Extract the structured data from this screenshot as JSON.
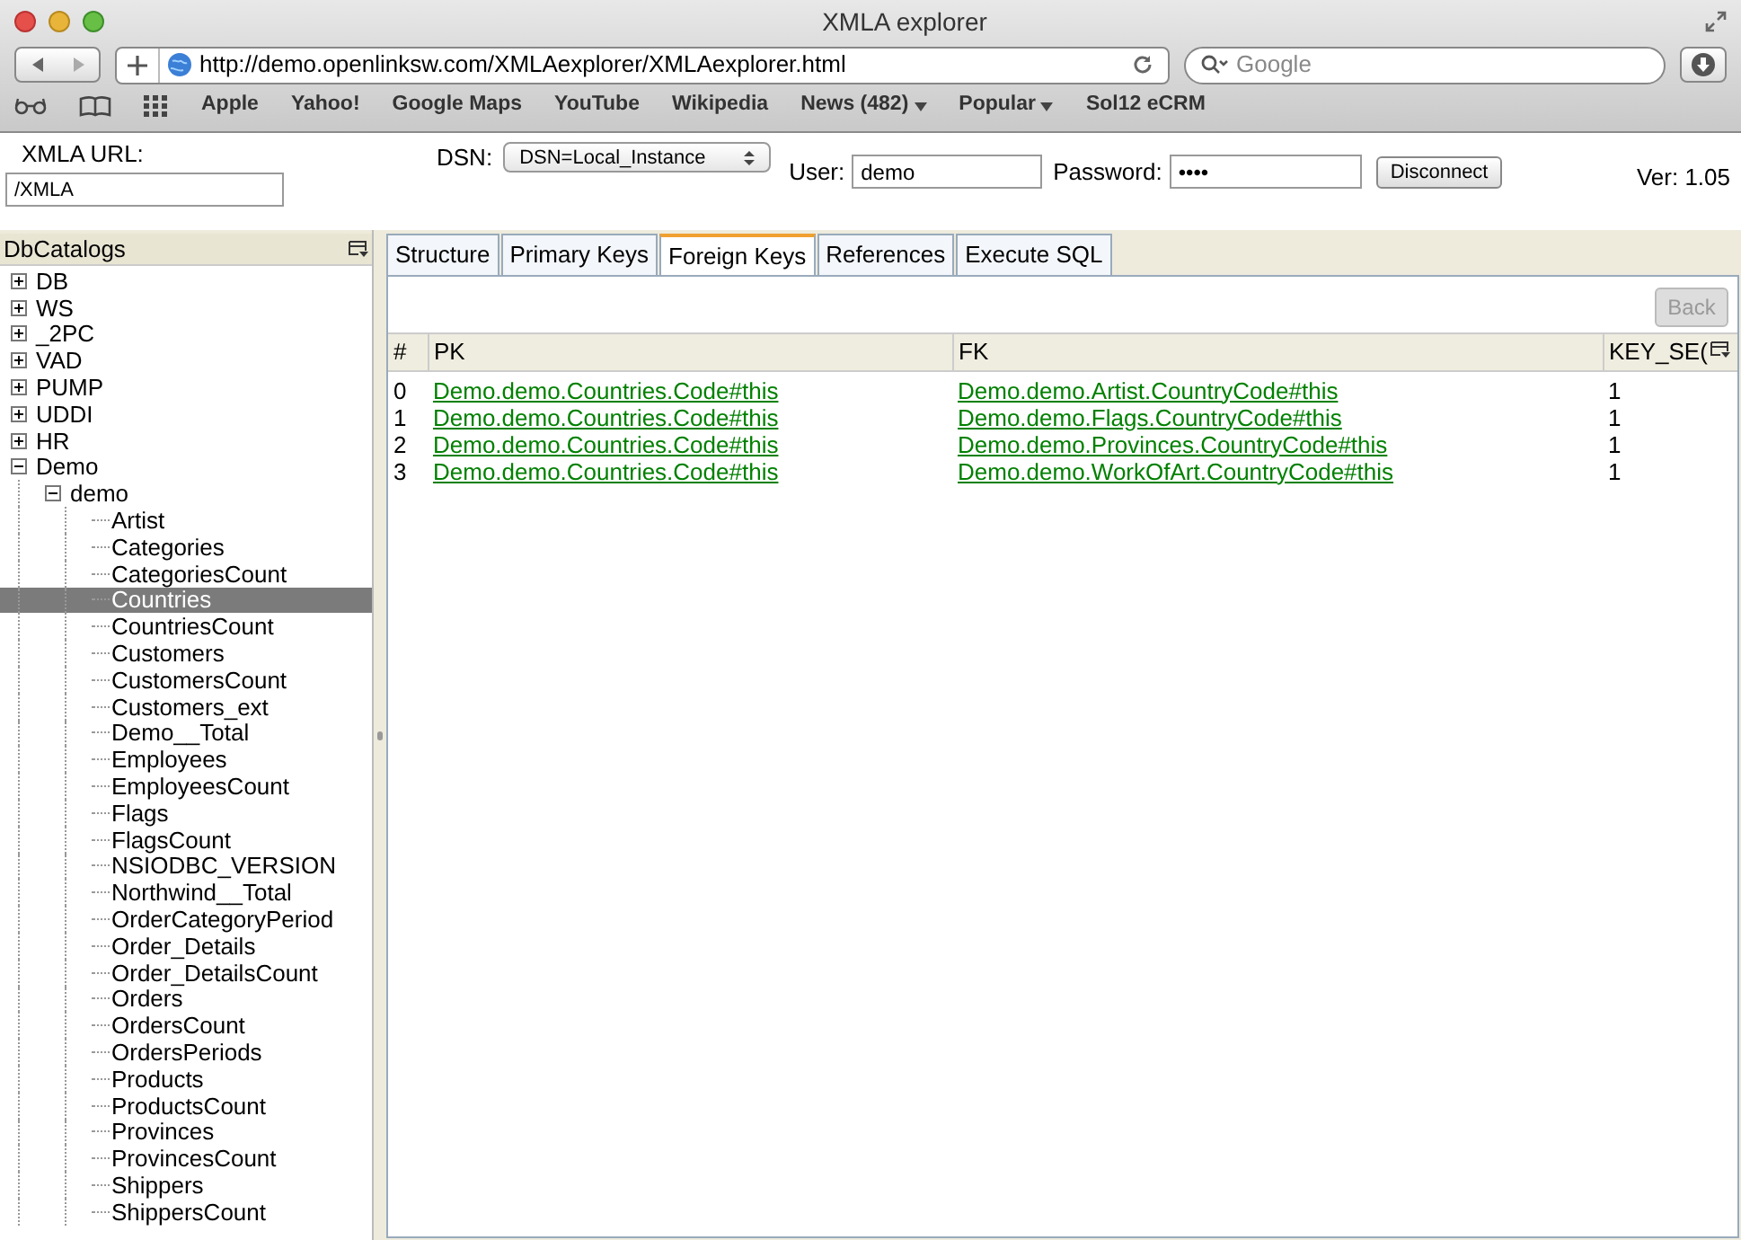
{
  "window": {
    "title": "XMLA explorer"
  },
  "browser": {
    "url": "http://demo.openlinksw.com/XMLAexplorer/XMLAexplorer.html",
    "search_placeholder": "Google",
    "bookmarks": [
      {
        "label": "Apple",
        "menu": false
      },
      {
        "label": "Yahoo!",
        "menu": false
      },
      {
        "label": "Google Maps",
        "menu": false
      },
      {
        "label": "YouTube",
        "menu": false
      },
      {
        "label": "Wikipedia",
        "menu": false
      },
      {
        "label": "News (482)",
        "menu": true
      },
      {
        "label": "Popular",
        "menu": true
      },
      {
        "label": "Sol12 eCRM",
        "menu": false
      }
    ]
  },
  "header": {
    "xmla_url_label": "XMLA URL:",
    "xmla_url": "/XMLA",
    "dsn_label": "DSN:",
    "dsn": "DSN=Local_Instance",
    "user_label": "User:",
    "user": "demo",
    "password_label": "Password:",
    "password": "••••",
    "disconnect": "Disconnect",
    "version": "Ver: 1.05"
  },
  "sidebar": {
    "title": "DbCatalogs",
    "items": [
      {
        "label": "DB",
        "expanded": false,
        "selected": false
      },
      {
        "label": "WS",
        "expanded": false,
        "selected": false
      },
      {
        "label": "_2PC",
        "expanded": false,
        "selected": false
      },
      {
        "label": "VAD",
        "expanded": false,
        "selected": false
      },
      {
        "label": "PUMP",
        "expanded": false,
        "selected": false
      },
      {
        "label": "UDDI",
        "expanded": false,
        "selected": false
      },
      {
        "label": "HR",
        "expanded": false,
        "selected": false
      },
      {
        "label": "Demo",
        "expanded": true,
        "selected": false,
        "children": [
          {
            "label": "demo",
            "expanded": true,
            "selected": false,
            "children": [
              {
                "label": "Artist",
                "selected": false
              },
              {
                "label": "Categories",
                "selected": false
              },
              {
                "label": "CategoriesCount",
                "selected": false
              },
              {
                "label": "Countries",
                "selected": true
              },
              {
                "label": "CountriesCount",
                "selected": false
              },
              {
                "label": "Customers",
                "selected": false
              },
              {
                "label": "CustomersCount",
                "selected": false
              },
              {
                "label": "Customers_ext",
                "selected": false
              },
              {
                "label": "Demo__Total",
                "selected": false
              },
              {
                "label": "Employees",
                "selected": false
              },
              {
                "label": "EmployeesCount",
                "selected": false
              },
              {
                "label": "Flags",
                "selected": false
              },
              {
                "label": "FlagsCount",
                "selected": false
              },
              {
                "label": "NSIODBC_VERSION",
                "selected": false
              },
              {
                "label": "Northwind__Total",
                "selected": false
              },
              {
                "label": "OrderCategoryPeriod",
                "selected": false
              },
              {
                "label": "Order_Details",
                "selected": false
              },
              {
                "label": "Order_DetailsCount",
                "selected": false
              },
              {
                "label": "Orders",
                "selected": false
              },
              {
                "label": "OrdersCount",
                "selected": false
              },
              {
                "label": "OrdersPeriods",
                "selected": false
              },
              {
                "label": "Products",
                "selected": false
              },
              {
                "label": "ProductsCount",
                "selected": false
              },
              {
                "label": "Provinces",
                "selected": false
              },
              {
                "label": "ProvincesCount",
                "selected": false
              },
              {
                "label": "Shippers",
                "selected": false
              },
              {
                "label": "ShippersCount",
                "selected": false
              }
            ]
          }
        ]
      }
    ]
  },
  "tabs": [
    {
      "label": "Structure",
      "selected": false
    },
    {
      "label": "Primary Keys",
      "selected": false
    },
    {
      "label": "Foreign Keys",
      "selected": true
    },
    {
      "label": "References",
      "selected": false
    },
    {
      "label": "Execute SQL",
      "selected": false
    }
  ],
  "back_button": {
    "label": "Back",
    "disabled": true
  },
  "table": {
    "columns": [
      "#",
      "PK",
      "FK",
      "KEY_SE("
    ],
    "rows": [
      [
        "0",
        "Demo.demo.Countries.Code#this",
        "Demo.demo.Artist.CountryCode#this",
        "1"
      ],
      [
        "1",
        "Demo.demo.Countries.Code#this",
        "Demo.demo.Flags.CountryCode#this",
        "1"
      ],
      [
        "2",
        "Demo.demo.Countries.Code#this",
        "Demo.demo.Provinces.CountryCode#this",
        "1"
      ],
      [
        "3",
        "Demo.demo.Countries.Code#this",
        "Demo.demo.WorkOfArt.CountryCode#this",
        "1"
      ]
    ]
  }
}
